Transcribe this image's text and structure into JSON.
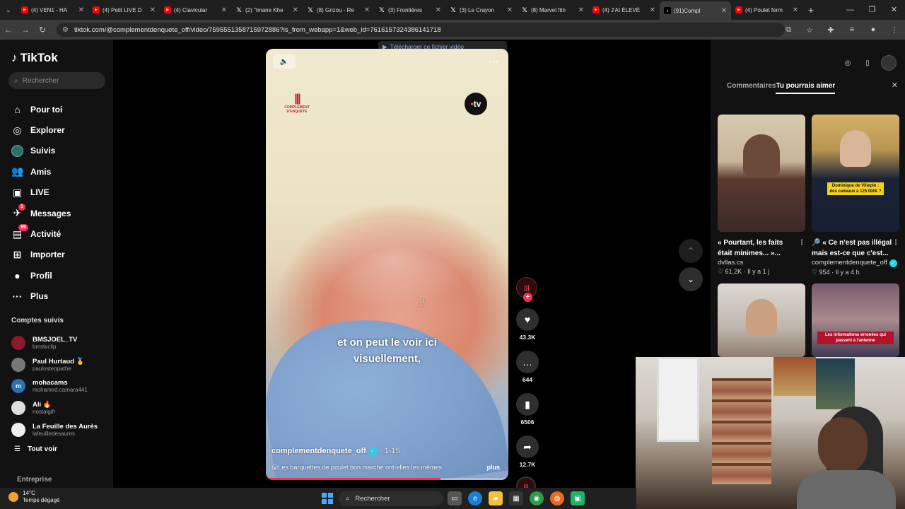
{
  "browser": {
    "tabs": [
      {
        "label": "(4) VEN1 - HA",
        "kind": "yt"
      },
      {
        "label": "(4) Petit LIVE D",
        "kind": "yt"
      },
      {
        "label": "(4) Clavicular",
        "kind": "yt"
      },
      {
        "label": "(2) \"Imane Khe",
        "kind": "x"
      },
      {
        "label": "(8) Grizou - Re",
        "kind": "x"
      },
      {
        "label": "(3) Frontières",
        "kind": "x"
      },
      {
        "label": "(3) Le Crayon",
        "kind": "x"
      },
      {
        "label": "(8) Marvel fitn",
        "kind": "x"
      },
      {
        "label": "(4) J'AI ÉLEVÉ",
        "kind": "yt"
      },
      {
        "label": "(91)Compl",
        "kind": "tt",
        "active": true
      },
      {
        "label": "(4) Poulet ferm",
        "kind": "yt"
      }
    ],
    "url": "tiktok.com/@complementdenquete_off/video/7595551358715972886?is_from_webapp=1&web_id=7616157324386141718"
  },
  "tiktok": {
    "logo": "TikTok",
    "search_placeholder": "Rechercher",
    "nav": [
      {
        "label": "Pour toi",
        "icon": "home-icon",
        "glyph": "⌂"
      },
      {
        "label": "Explorer",
        "icon": "compass-icon",
        "glyph": "◎"
      },
      {
        "label": "Suivis",
        "icon": "following-avatar-icon",
        "glyph": ""
      },
      {
        "label": "Amis",
        "icon": "friends-icon",
        "glyph": "👥"
      },
      {
        "label": "LIVE",
        "icon": "live-icon",
        "glyph": "▣"
      },
      {
        "label": "Messages",
        "icon": "messages-icon",
        "glyph": "✈",
        "badge": "1"
      },
      {
        "label": "Activité",
        "icon": "activity-icon",
        "glyph": "▤",
        "badge": "99"
      },
      {
        "label": "Importer",
        "icon": "upload-icon",
        "glyph": "⊞"
      },
      {
        "label": "Profil",
        "icon": "profile-icon",
        "glyph": "●"
      },
      {
        "label": "Plus",
        "icon": "more-icon",
        "glyph": "···"
      }
    ],
    "following_title": "Comptes suivis",
    "following": [
      {
        "name": "BMSJOEL_TV",
        "handle": "bmstvclip",
        "color": "#8b1a2b",
        "initial": ""
      },
      {
        "name": "Paul Hurtaud 🥇",
        "handle": "paulosteopathe",
        "color": "#777",
        "initial": ""
      },
      {
        "name": "mohacams",
        "handle": "mohamed.camara441",
        "color": "#2f6fb5",
        "initial": "m"
      },
      {
        "name": "Ali 🔥",
        "handle": "nostalgifr",
        "color": "#ddd",
        "initial": ""
      },
      {
        "name": "La Feuille des Aurès",
        "handle": "lafeuilledesaures",
        "color": "#eee",
        "initial": ""
      }
    ],
    "see_all": "Tout voir",
    "business": "Entreprise"
  },
  "download_bar": "Télécharger ce fichier vidéo",
  "video": {
    "subtitle_line1": "et on peut le voir ici",
    "subtitle_line2": "visuellement,",
    "brand_small": "COMPLÉMENT D'ENQUÊTE",
    "tv_logo": "tv",
    "author": "complementdenquete_off",
    "date": "1-15",
    "description": "😮Les barquettes de poulet bon marché ont-elles les mêmes",
    "more": "plus",
    "progress": 0.72
  },
  "actions": {
    "likes": "43.3K",
    "comments": "644",
    "saves": "6506",
    "shares": "12.7K"
  },
  "right_panel": {
    "tabs": [
      "Commentaires",
      "Tu pourrais aimer"
    ],
    "active_tab": "Tu pourrais aimer",
    "cards": [
      {
        "title": "« Pourtant, les faits était minimes... »...",
        "author": "dvllas.cs",
        "likes": "61.2K",
        "age": "Il y a 1 j",
        "verified": false
      },
      {
        "title": "🔎 « Ce n'est pas illégal mais est-ce que c'est...",
        "author": "complementdenquete_off",
        "likes": "954",
        "age": "Il y a 4 h",
        "verified": true,
        "caption": "Dominique de Villepin : des cadeaux à 125 000€ ?"
      },
      {
        "title": "",
        "author": "",
        "likes": "",
        "age": ""
      },
      {
        "title": "",
        "author": "",
        "likes": "",
        "age": "",
        "caption": "Les informations erronées qui passent à l'antenne"
      }
    ]
  },
  "taskbar": {
    "temp": "14°C",
    "weather": "Temps dégagé",
    "search": "Rechercher"
  }
}
